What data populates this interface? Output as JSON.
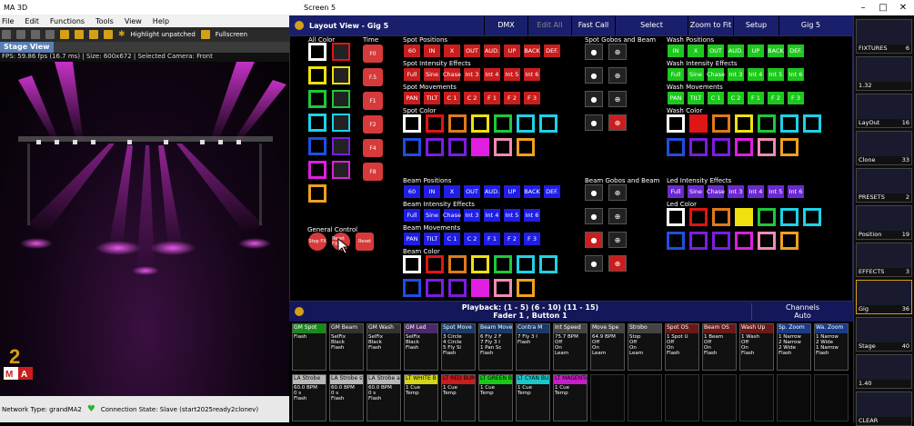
{
  "ma3d": {
    "title": "MA 3D",
    "menu": [
      "File",
      "Edit",
      "Functions",
      "Tools",
      "View",
      "Help"
    ],
    "highlight": "Highlight unpatched",
    "fullscreen": "Fullscreen",
    "tab": "Stage View",
    "info": "FPS: 59.86 fps (16.7 ms) | Size: 600x672 | Selected Camera: Front",
    "network": "Network Type: grandMA2",
    "connection": "Connection State: Slave (start2025ready2clonev)",
    "logo_text": "grandMA"
  },
  "screen": {
    "title": "Screen 5",
    "layout_title": "Layout View - Gig 5",
    "buttons": [
      "DMX",
      "Edit All",
      "Fast Call",
      "Select",
      "Zoom to Fit",
      "Setup",
      "Gig 5"
    ]
  },
  "layout": {
    "all_color": "All Color",
    "time": "Time",
    "time_buttons": [
      "F0",
      "F.5",
      "F1",
      "F2",
      "F4",
      "F8"
    ],
    "spot_positions": "Spot Positions",
    "spot_pos_btns": [
      "60",
      "IN",
      "X",
      "OUT",
      "AUD.",
      "UP",
      "BACK",
      "DEF."
    ],
    "spot_intensity": "Spot Intensity Effects",
    "spot_int_btns": [
      "Full",
      "Sine",
      "Chase",
      "Int 3",
      "Int 4",
      "Int 5",
      "Int 6"
    ],
    "spot_movements": "Spot Movements",
    "spot_mov_btns": [
      "PAN",
      "TILT",
      "C 1",
      "C 2",
      "F 1",
      "F 2",
      "F 3"
    ],
    "spot_color": "Spot Color",
    "spot_gobos": "Spot Gobos and Beam",
    "wash_positions": "Wash Positions",
    "wash_pos_btns": [
      "IN",
      "X",
      "OUT",
      "AUD.",
      "UP",
      "BACK",
      "DEF."
    ],
    "wash_intensity": "Wash Intensity Effects",
    "wash_int_btns": [
      "Full",
      "Sine",
      "Chase",
      "Int 3",
      "Int 4",
      "Int 5",
      "Int 6"
    ],
    "wash_movements": "Wash Movements",
    "wash_mov_btns": [
      "PAN",
      "TILT",
      "C 1",
      "C 2",
      "F 1",
      "F 2",
      "F 3"
    ],
    "wash_color": "Wash Color",
    "beam_positions": "Beam Positions",
    "beam_pos_btns": [
      "60",
      "IN",
      "X",
      "OUT",
      "AUD.",
      "UP",
      "BACK",
      "DEF."
    ],
    "beam_intensity": "Beam Intensity Effects",
    "beam_int_btns": [
      "Full",
      "Sine",
      "Chase",
      "Int 3",
      "Int 4",
      "Int 5",
      "Int 6"
    ],
    "beam_movements": "Beam Movements",
    "beam_mov_btns": [
      "PAN",
      "TILT",
      "C 1",
      "C 2",
      "F 1",
      "F 2",
      "F 3"
    ],
    "beam_color": "Beam Color",
    "beam_gobos": "Beam Gobos and Beam",
    "led_intensity": "Led Intensity Effects",
    "led_int_btns": [
      "Full",
      "Sine",
      "Chase",
      "Int 3",
      "Int 4",
      "Int 5",
      "Int 6"
    ],
    "led_color": "Led Color",
    "general_control": "General Control",
    "gen_btns": [
      "Stop FX",
      "Reset FX",
      "Reset"
    ]
  },
  "colors": {
    "white": "#ffffff",
    "red": "#e01515",
    "orange": "#e07a1a",
    "yellow": "#f0e010",
    "green": "#1ec83c",
    "cyan": "#1ed2e6",
    "blue": "#1e50e0",
    "purple": "#7a1ee0",
    "magenta": "#e01ee0",
    "pink": "#f08cb4",
    "amber": "#f0a020",
    "accent": "#d4a017",
    "spot_btn": "#c81e1e",
    "wash_btn": "#1ec81e",
    "beam_btn": "#1e1ee6",
    "led_btn": "#6a2ad2"
  },
  "sidebar": [
    {
      "label": "FIXTURES",
      "num": "6"
    },
    {
      "label": "1.32",
      "num": ""
    },
    {
      "label": "LayOut",
      "num": "16"
    },
    {
      "label": "Clone",
      "num": "33"
    },
    {
      "label": "PRESETS",
      "num": "2"
    },
    {
      "label": "Position",
      "num": "19"
    },
    {
      "label": "EFFECTS",
      "num": "3"
    },
    {
      "label": "Gig",
      "num": "36"
    },
    {
      "label": "Stage",
      "num": "40"
    },
    {
      "label": "1.40",
      "num": ""
    },
    {
      "label": "CLEAR",
      "num": ""
    }
  ],
  "playback": {
    "header": "Playback: (1 - 5) (6 - 10) (11 - 15)",
    "fader": "Fader  1 , Button  1",
    "channels": "Channels",
    "auto": "Auto"
  },
  "executors_row1": [
    {
      "num": "1",
      "page": "P",
      "name": "GM Spot",
      "lines": [
        "",
        "",
        "",
        "Flash"
      ]
    },
    {
      "num": "2",
      "page": "P",
      "name": "GM Beam",
      "lines": [
        "SelFix",
        "Black",
        "Flash",
        ""
      ]
    },
    {
      "num": "3",
      "page": "P",
      "name": "GM Wash",
      "lines": [
        "SelFix",
        "Black",
        "Flash",
        ""
      ]
    },
    {
      "num": "4",
      "page": "P",
      "name": "GM Led",
      "lines": [
        "SelFix",
        "Black",
        "Flash",
        ""
      ]
    },
    {
      "num": "5",
      "page": "L",
      "name": "Spot Move",
      "lines": [
        "3 Circle",
        "4 Circle",
        "5 Fly Si",
        "Flash"
      ]
    },
    {
      "num": "6",
      "page": "L",
      "name": "Beam Move",
      "lines": [
        "6 Fly 2 F",
        "7 Fly 3 I",
        "1 Pan Sc",
        "Flash"
      ]
    },
    {
      "num": "7",
      "page": "L",
      "name": "Contra M",
      "lines": [
        "7 Fly 3 I",
        "",
        "",
        "Flash"
      ]
    },
    {
      "num": "8",
      "page": "L",
      "name": "Int Speed",
      "lines": [
        "75.7 BPM",
        "Off",
        "On",
        "Learn"
      ]
    },
    {
      "num": "9",
      "page": "L",
      "name": "Move Spe",
      "lines": [
        "64.9 BPM",
        "Off",
        "On",
        "Learn"
      ]
    },
    {
      "num": "10",
      "page": "L",
      "name": "Strobo",
      "lines": [
        "Stop",
        "Off",
        "On",
        "Learn"
      ]
    },
    {
      "num": "11",
      "page": "LT",
      "name": "Spot OS",
      "lines": [
        "1 Spot U",
        "Off",
        "On",
        "Flash"
      ]
    },
    {
      "num": "12",
      "page": "LT",
      "name": "Beam OS",
      "lines": [
        "1 Beam",
        "Off",
        "On",
        "Flash"
      ]
    },
    {
      "num": "13",
      "page": "LT",
      "name": "Wash Up",
      "lines": [
        "1 Wash",
        "Off",
        "On",
        "Flash"
      ]
    },
    {
      "num": "14",
      "page": "LT",
      "name": "Sp. Zoom",
      "lines": [
        "1 Narrow",
        "2 Narrow",
        "2 Wide",
        "Flash"
      ]
    },
    {
      "num": "15",
      "page": "LT",
      "name": "Wa. Zoom",
      "lines": [
        "1 Narrow",
        "2 Wide",
        "1 Narrow",
        "Flash"
      ]
    }
  ],
  "executors_row2": [
    {
      "num": "101",
      "name": "LA Strobe",
      "lines": [
        "60.0 BPM",
        "0 s",
        "Flash"
      ]
    },
    {
      "num": "102",
      "name": "LA Strobe sy",
      "lines": [
        "60.0 BPM",
        "0 s",
        "Flash"
      ]
    },
    {
      "num": "103",
      "name": "LA Strobe al",
      "lines": [
        "60.0 BPM",
        "0 s",
        "Flash"
      ]
    },
    {
      "num": "104",
      "name": "LT WHITE B",
      "lines": [
        "1 Cue",
        "Temp",
        ""
      ]
    },
    {
      "num": "105",
      "name": "LT RED BUM",
      "lines": [
        "1 Cue",
        "Temp",
        ""
      ]
    },
    {
      "num": "106",
      "name": "LT GREEN BU",
      "lines": [
        "1 Cue",
        "Temp",
        ""
      ]
    },
    {
      "num": "107",
      "name": "LT CYAN BU",
      "lines": [
        "1 Cue",
        "Temp",
        ""
      ]
    },
    {
      "num": "108",
      "name": "LT MAGENTA",
      "lines": [
        "1 Cue",
        "Temp",
        ""
      ]
    }
  ]
}
